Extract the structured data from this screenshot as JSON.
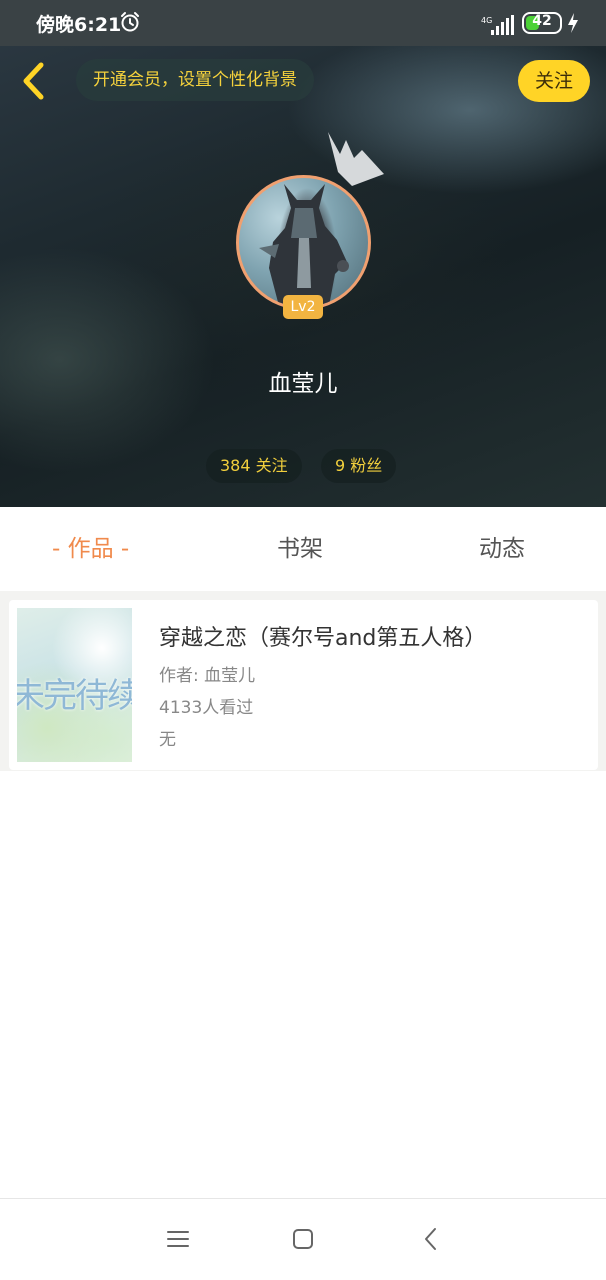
{
  "status_bar": {
    "time": "傍晚6:21",
    "network": "4G",
    "battery": "42",
    "battery_level": 0.42
  },
  "header": {
    "vip_banner": "开通会员，设置个性化背景",
    "follow_label": "关注",
    "level": "Lv2",
    "username": "血莹儿",
    "stats": {
      "following": "384 关注",
      "fans": "9 粉丝"
    },
    "colors": {
      "accent": "#ffd426",
      "stat_text": "#f1cf3d",
      "avatar_ring": "#f0a070"
    }
  },
  "tabs": {
    "works": "- 作品 -",
    "shelf": "书架",
    "feed": "动态",
    "active": "works",
    "active_color": "#f08a4c"
  },
  "works": [
    {
      "cover_text": "未完待续",
      "title": "穿越之恋（赛尔号and第五人格）",
      "author": "作者: 血莹儿",
      "views": "4133人看过",
      "intro": "无"
    }
  ],
  "nav": {
    "icons": [
      "menu-icon",
      "home-icon",
      "back-icon"
    ]
  }
}
